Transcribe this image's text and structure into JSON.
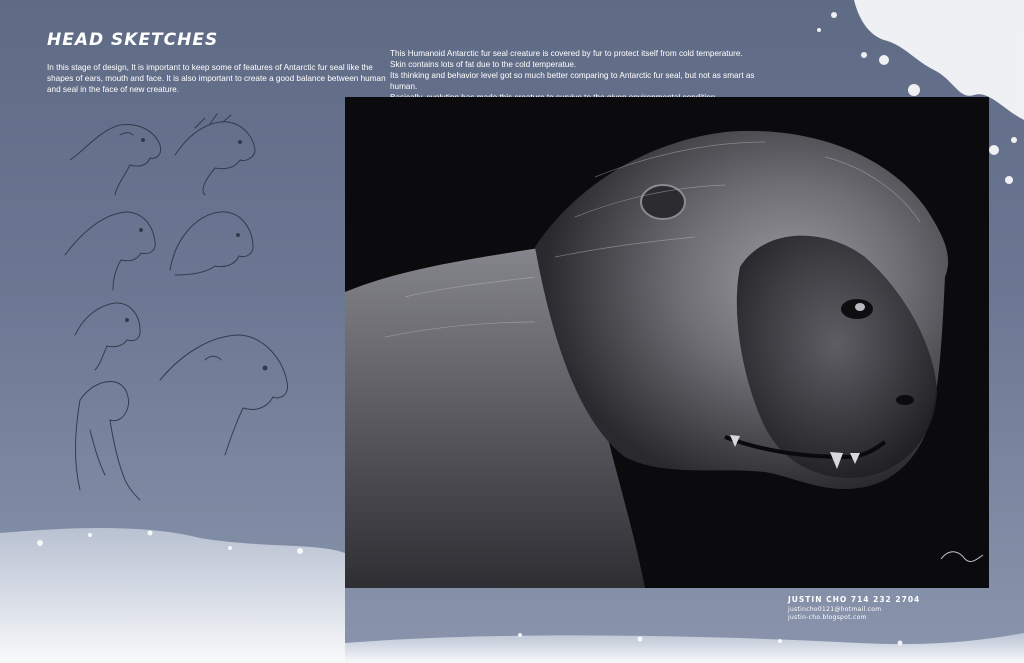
{
  "page": {
    "title": "HEAD SKETCHES",
    "intro_text": "In this stage of design, It is important to keep some of features of Antarctic fur seal like the shapes of ears, mouth and face. It is also important to create a good balance between human and seal in the face of new creature.",
    "description": [
      "This Humanoid Antarctic fur seal creature is covered by fur to protect itself from cold temperature.",
      "Skin contains lots of fat due to the cold temperatue.",
      "Its thinking and behavior level got so much better comparing to Antarctic fur seal, but not as smart as human.",
      "Basically, evolution has made this creature to survive to the given environmental condition."
    ]
  },
  "contact": {
    "name_phone": "JUSTIN CHO 714 232 2704",
    "email": "justincho0121@hotmail.com",
    "blog": "justin-cho.blogspot.com"
  },
  "colors": {
    "background": "#6c7893",
    "art_background": "#0b0b0d",
    "text": "#ffffff"
  }
}
